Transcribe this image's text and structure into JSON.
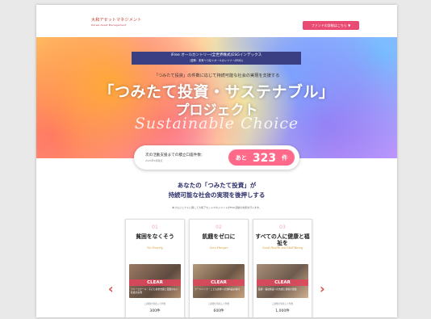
{
  "header": {
    "logo_text": "大和アセットマネジメント",
    "logo_sub": "Daiwa Asset Management",
    "cta_label": "ファンドの詳細はこちら ▼"
  },
  "hero": {
    "esg_line1": "iFree オールカントリー(全世界株式)ESGインデックス",
    "esg_line2": "(愛称：未来へつなぐオールカントリー(ESG))",
    "tagline": "「つみたて投資」の件数に応じて持続可能な社会の実現を支援する",
    "title_line1": "「つみたて投資・サステナブル」",
    "title_line2": "プロジェクト",
    "script": "Sustainable Choice"
  },
  "counter": {
    "label": "次の活動支援までの積立口座件数：",
    "date": "2024年6月時点",
    "prefix": "あと",
    "value": "323",
    "suffix": "件"
  },
  "lead": {
    "line1": "あなたの「つみたて投資」が",
    "line2": "持続可能な社会の実現を後押しする",
    "note": "本プロジェクトに関して大和アセットマネジメントがESG活動の支援を行います。"
  },
  "cards": [
    {
      "number": "01",
      "title": "貧困をなくそう",
      "script": "No Poverty",
      "clear": "CLEAR",
      "desc": "フリースクール・子ども食堂支援と貧困のない社会の実現",
      "count_label": "口座数が到達した件数",
      "count": "300件"
    },
    {
      "number": "02",
      "title": "飢餓をゼロに",
      "script": "Zero Hunger",
      "clear": "CLEAR",
      "desc": "フードバンク・こども食堂への食料品の寄付",
      "count_label": "口座数が到達した件数",
      "count": "600件"
    },
    {
      "number": "03",
      "title": "すべての人に健康と福祉を",
      "script": "Good Health and Well-Being",
      "clear": "CLEAR",
      "desc": "医療・福祉施設への支援と健康の促進",
      "count_label": "口座数が到達した件数",
      "count": "1,000件"
    }
  ],
  "nav": {
    "prev": "‹",
    "next": "›"
  }
}
